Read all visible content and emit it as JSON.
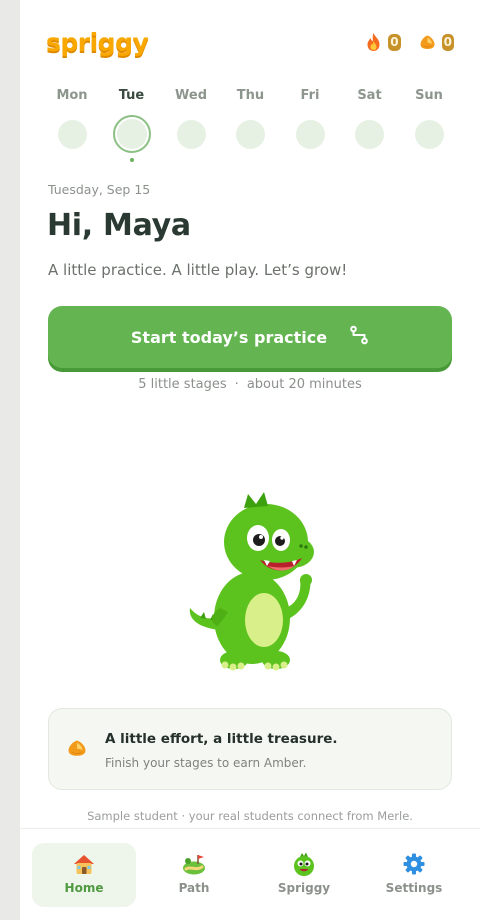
{
  "header": {
    "logo_text": "spriggy",
    "streak_count": "0",
    "amber_count": "0"
  },
  "week": {
    "days": [
      "Mon",
      "Tue",
      "Wed",
      "Thu",
      "Fri",
      "Sat",
      "Sun"
    ],
    "today": "Tue"
  },
  "main": {
    "date": "Tuesday, Sep 15",
    "greeting": "Hi, Maya",
    "tagline": "A little practice. A little play. Let’s grow!",
    "cta_label": "Start today’s practice",
    "cta_stages": "5 little stages",
    "cta_separator": "·",
    "cta_duration": "about 20 minutes"
  },
  "reward": {
    "title": "A little effort, a little treasure.",
    "subtitle": "Finish your stages to earn Amber."
  },
  "footnote": "Sample student · your real students connect from Merle.",
  "nav": {
    "items": [
      {
        "label": "Home",
        "icon": "home-icon"
      },
      {
        "label": "Path",
        "icon": "path-icon"
      },
      {
        "label": "Spriggy",
        "icon": "spriggy-icon"
      },
      {
        "label": "Settings",
        "icon": "gear-icon"
      }
    ],
    "active": "Home"
  },
  "colors": {
    "primary_green": "#64b552",
    "logo_orange": "#f8a800",
    "text_dark": "#2a3a32"
  }
}
